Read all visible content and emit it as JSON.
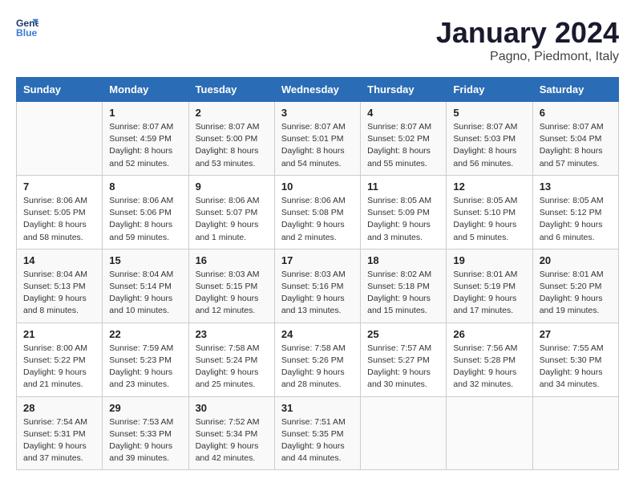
{
  "header": {
    "logo_line1": "General",
    "logo_line2": "Blue",
    "month": "January 2024",
    "location": "Pagno, Piedmont, Italy"
  },
  "weekdays": [
    "Sunday",
    "Monday",
    "Tuesday",
    "Wednesday",
    "Thursday",
    "Friday",
    "Saturday"
  ],
  "weeks": [
    [
      {
        "day": "",
        "info": ""
      },
      {
        "day": "1",
        "info": "Sunrise: 8:07 AM\nSunset: 4:59 PM\nDaylight: 8 hours\nand 52 minutes."
      },
      {
        "day": "2",
        "info": "Sunrise: 8:07 AM\nSunset: 5:00 PM\nDaylight: 8 hours\nand 53 minutes."
      },
      {
        "day": "3",
        "info": "Sunrise: 8:07 AM\nSunset: 5:01 PM\nDaylight: 8 hours\nand 54 minutes."
      },
      {
        "day": "4",
        "info": "Sunrise: 8:07 AM\nSunset: 5:02 PM\nDaylight: 8 hours\nand 55 minutes."
      },
      {
        "day": "5",
        "info": "Sunrise: 8:07 AM\nSunset: 5:03 PM\nDaylight: 8 hours\nand 56 minutes."
      },
      {
        "day": "6",
        "info": "Sunrise: 8:07 AM\nSunset: 5:04 PM\nDaylight: 8 hours\nand 57 minutes."
      }
    ],
    [
      {
        "day": "7",
        "info": "Sunrise: 8:06 AM\nSunset: 5:05 PM\nDaylight: 8 hours\nand 58 minutes."
      },
      {
        "day": "8",
        "info": "Sunrise: 8:06 AM\nSunset: 5:06 PM\nDaylight: 8 hours\nand 59 minutes."
      },
      {
        "day": "9",
        "info": "Sunrise: 8:06 AM\nSunset: 5:07 PM\nDaylight: 9 hours\nand 1 minute."
      },
      {
        "day": "10",
        "info": "Sunrise: 8:06 AM\nSunset: 5:08 PM\nDaylight: 9 hours\nand 2 minutes."
      },
      {
        "day": "11",
        "info": "Sunrise: 8:05 AM\nSunset: 5:09 PM\nDaylight: 9 hours\nand 3 minutes."
      },
      {
        "day": "12",
        "info": "Sunrise: 8:05 AM\nSunset: 5:10 PM\nDaylight: 9 hours\nand 5 minutes."
      },
      {
        "day": "13",
        "info": "Sunrise: 8:05 AM\nSunset: 5:12 PM\nDaylight: 9 hours\nand 6 minutes."
      }
    ],
    [
      {
        "day": "14",
        "info": "Sunrise: 8:04 AM\nSunset: 5:13 PM\nDaylight: 9 hours\nand 8 minutes."
      },
      {
        "day": "15",
        "info": "Sunrise: 8:04 AM\nSunset: 5:14 PM\nDaylight: 9 hours\nand 10 minutes."
      },
      {
        "day": "16",
        "info": "Sunrise: 8:03 AM\nSunset: 5:15 PM\nDaylight: 9 hours\nand 12 minutes."
      },
      {
        "day": "17",
        "info": "Sunrise: 8:03 AM\nSunset: 5:16 PM\nDaylight: 9 hours\nand 13 minutes."
      },
      {
        "day": "18",
        "info": "Sunrise: 8:02 AM\nSunset: 5:18 PM\nDaylight: 9 hours\nand 15 minutes."
      },
      {
        "day": "19",
        "info": "Sunrise: 8:01 AM\nSunset: 5:19 PM\nDaylight: 9 hours\nand 17 minutes."
      },
      {
        "day": "20",
        "info": "Sunrise: 8:01 AM\nSunset: 5:20 PM\nDaylight: 9 hours\nand 19 minutes."
      }
    ],
    [
      {
        "day": "21",
        "info": "Sunrise: 8:00 AM\nSunset: 5:22 PM\nDaylight: 9 hours\nand 21 minutes."
      },
      {
        "day": "22",
        "info": "Sunrise: 7:59 AM\nSunset: 5:23 PM\nDaylight: 9 hours\nand 23 minutes."
      },
      {
        "day": "23",
        "info": "Sunrise: 7:58 AM\nSunset: 5:24 PM\nDaylight: 9 hours\nand 25 minutes."
      },
      {
        "day": "24",
        "info": "Sunrise: 7:58 AM\nSunset: 5:26 PM\nDaylight: 9 hours\nand 28 minutes."
      },
      {
        "day": "25",
        "info": "Sunrise: 7:57 AM\nSunset: 5:27 PM\nDaylight: 9 hours\nand 30 minutes."
      },
      {
        "day": "26",
        "info": "Sunrise: 7:56 AM\nSunset: 5:28 PM\nDaylight: 9 hours\nand 32 minutes."
      },
      {
        "day": "27",
        "info": "Sunrise: 7:55 AM\nSunset: 5:30 PM\nDaylight: 9 hours\nand 34 minutes."
      }
    ],
    [
      {
        "day": "28",
        "info": "Sunrise: 7:54 AM\nSunset: 5:31 PM\nDaylight: 9 hours\nand 37 minutes."
      },
      {
        "day": "29",
        "info": "Sunrise: 7:53 AM\nSunset: 5:33 PM\nDaylight: 9 hours\nand 39 minutes."
      },
      {
        "day": "30",
        "info": "Sunrise: 7:52 AM\nSunset: 5:34 PM\nDaylight: 9 hours\nand 42 minutes."
      },
      {
        "day": "31",
        "info": "Sunrise: 7:51 AM\nSunset: 5:35 PM\nDaylight: 9 hours\nand 44 minutes."
      },
      {
        "day": "",
        "info": ""
      },
      {
        "day": "",
        "info": ""
      },
      {
        "day": "",
        "info": ""
      }
    ]
  ]
}
